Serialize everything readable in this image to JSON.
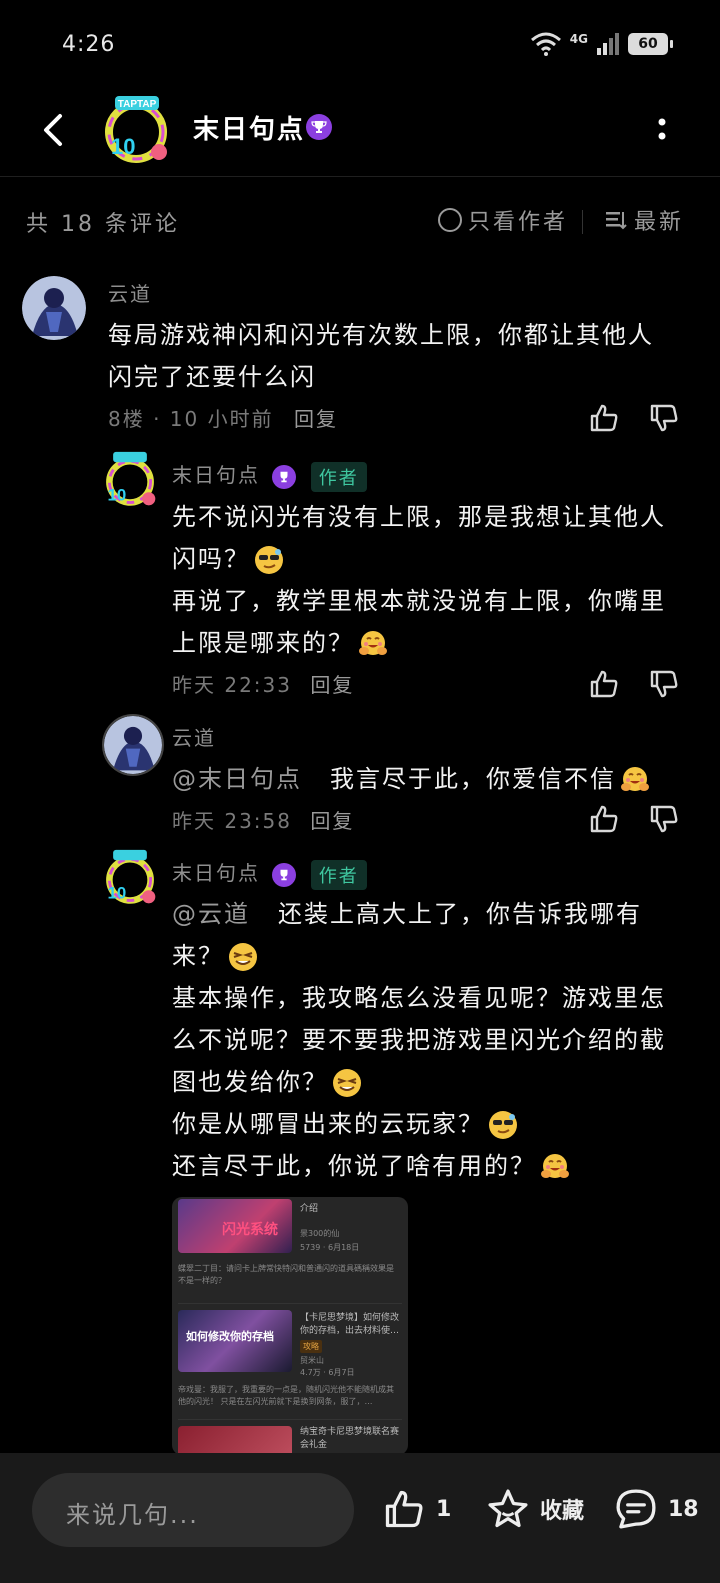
{
  "status": {
    "time": "4:26",
    "network": "4G",
    "battery": "60"
  },
  "header": {
    "title": "末日句点"
  },
  "comments_bar": {
    "count": "共 18 条评论",
    "author_only": "只看作者",
    "sort": "最新"
  },
  "comments": [
    {
      "name": "云道",
      "text": "每局游戏神闪和闪光有次数上限，你都让其他人闪完了还要什么闪",
      "meta": "8楼 · 10 小时前",
      "reply": "回复"
    }
  ],
  "replies": [
    {
      "name": "末日句点",
      "author_tag": "作者",
      "lines": [
        "先不说闪光有没有上限，那是我想让其他人闪吗？",
        "再说了，教学里根本就没说有上限，你嘴里上限是哪来的？"
      ],
      "meta": "昨天 22:33",
      "reply": "回复"
    },
    {
      "name": "云道",
      "mention": "@末日句点",
      "text": "我言尽于此，你爱信不信",
      "meta": "昨天 23:58",
      "reply": "回复"
    },
    {
      "name": "末日句点",
      "author_tag": "作者",
      "mention": "@云道",
      "lines": [
        "还装上高大上了，你告诉我哪有来？",
        "基本操作，我攻略怎么没看见呢？游戏里怎么不说呢？要不要我把游戏里闪光介绍的截图也发给你？",
        "你是从哪冒出来的云玩家？",
        "还言尽于此，你说了啥有用的？"
      ]
    }
  ],
  "screenshot": {
    "row1_title": "介绍",
    "row1_author": "景300的仙",
    "row1_stats": "5739 · 6月18日",
    "row1_comment": "蝶翠二丁目：请问卡上牌常快特闪和普通闪的道具碼稱效果是不是一样的？",
    "row1_img_text": "闪光系统",
    "row2_title": "【卡尼思梦境】如何修改你的存档，出去材料使…",
    "row2_tag": "攻略",
    "row2_author": "贸米山",
    "row2_stats": "4.7万 · 6月7日",
    "row2_comment": "帝戏曼：我服了，我重要的一点是，随机闪光他不能随机成其他的闪光！ 只是在左闪光前就下是换到网条，服了，…",
    "row2_img_text": "如何修改你的存档",
    "row3_title": "纳宝奇卡尼思梦境联名赛会礼金"
  },
  "bottom": {
    "placeholder": "来说几句...",
    "likes": "1",
    "favorite": "收藏",
    "comments": "18"
  },
  "colors": {
    "author_tag_bg": "#103028",
    "author_tag_fg": "#3fc7a0",
    "badge": "#8b3fe0",
    "background": "#000000"
  }
}
